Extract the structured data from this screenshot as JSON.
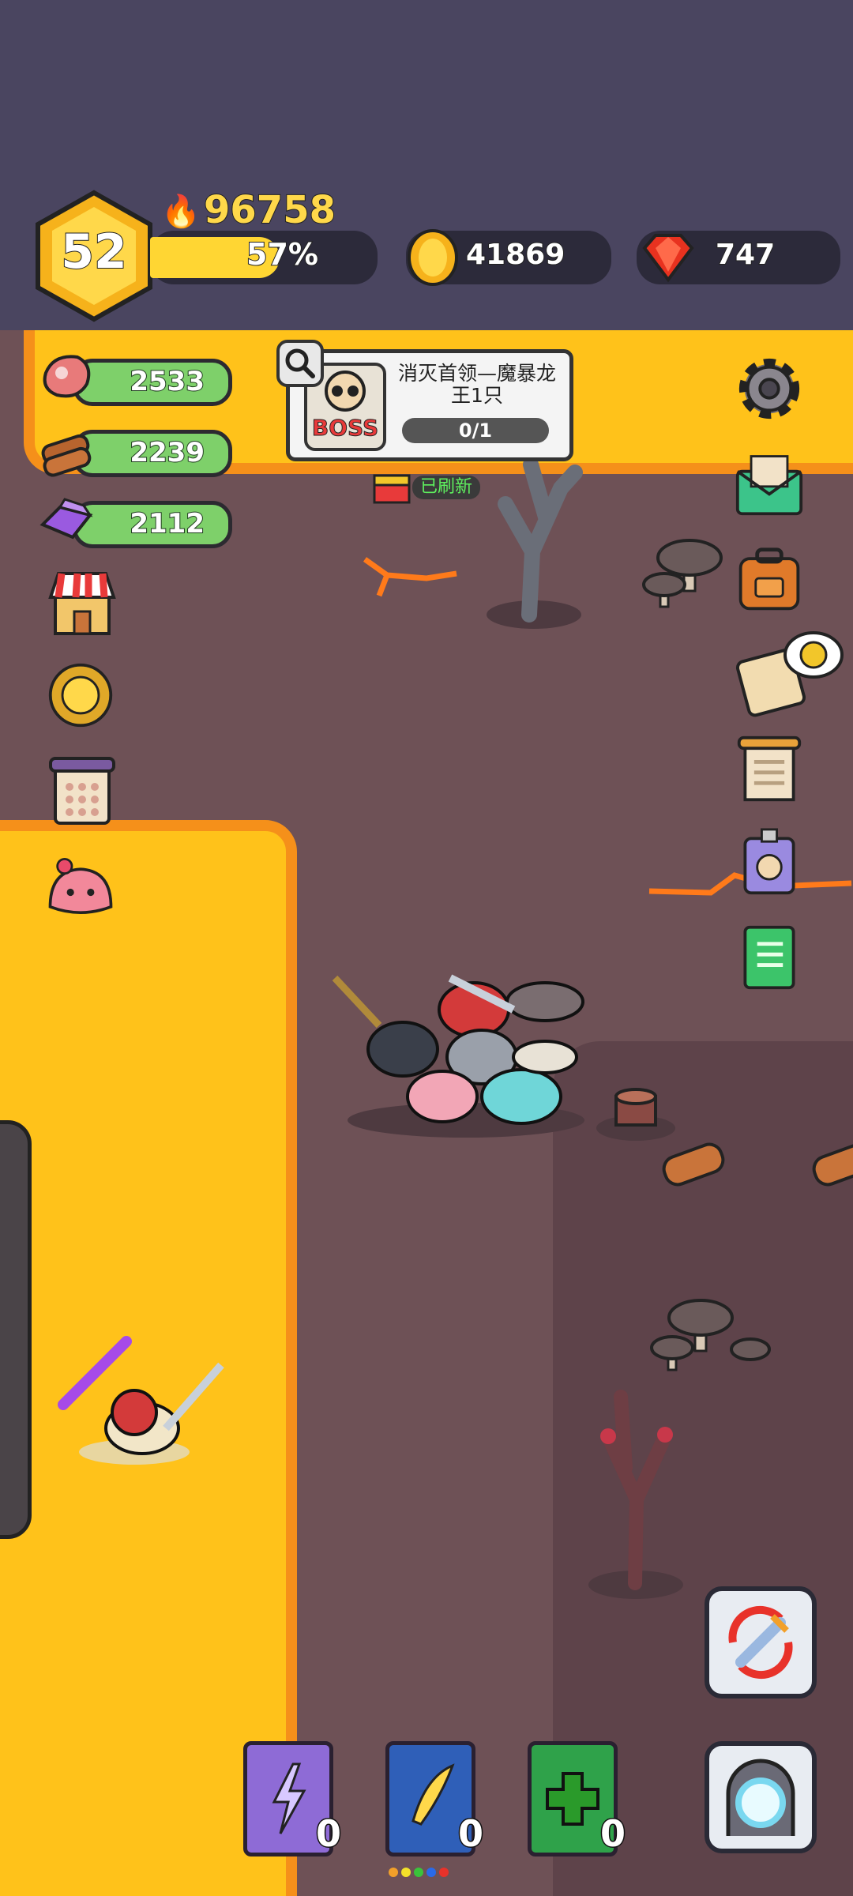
{
  "player": {
    "level": "52",
    "power": "96758",
    "xp_percent": "57%",
    "xp_fraction": 0.57
  },
  "currency": {
    "gold": "41869",
    "gems": "747"
  },
  "resources": {
    "meat": "2533",
    "wood": "2239",
    "crystal": "2112"
  },
  "quest": {
    "badge": "BOSS",
    "title": "消灭首领—魔暴龙王1只",
    "progress": "0/1",
    "refresh_label": "已刷新"
  },
  "skill_books": [
    {
      "name": "lightning-book",
      "count": "0",
      "color": "#8e6bd6"
    },
    {
      "name": "wing-book",
      "count": "0",
      "color": "#2f5fb8"
    },
    {
      "name": "heal-book",
      "count": "0",
      "color": "#2fa24a"
    }
  ],
  "colors": {
    "lava": "#ffc21a",
    "lava_edge": "#f5901a",
    "ground": "#6e5156",
    "topbar": "#4a4560",
    "xp_bar": "#ffd633"
  }
}
